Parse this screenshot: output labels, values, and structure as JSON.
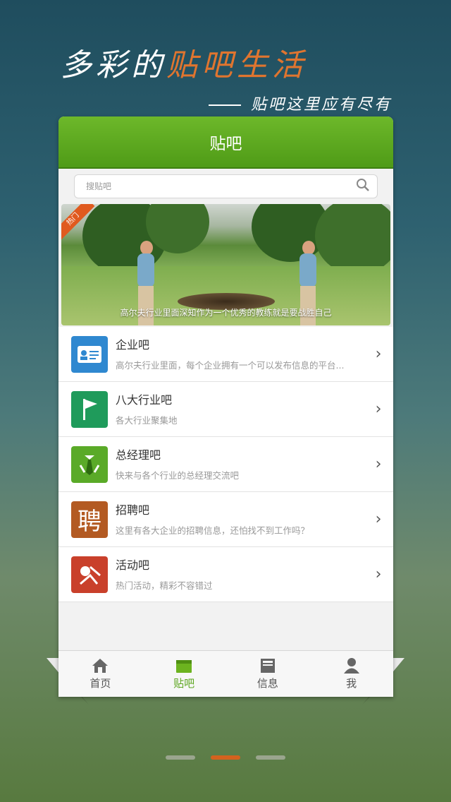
{
  "promo": {
    "headline_white": "多彩的",
    "headline_accent": "贴吧生活",
    "tagline": "贴吧这里应有尽有"
  },
  "app": {
    "title": "贴吧",
    "search": {
      "placeholder": "搜贴吧"
    },
    "banner": {
      "badge": "热门",
      "caption": "高尔夫行业里面深知作为一个优秀的教练就是要战胜自己"
    },
    "items": [
      {
        "title": "企业吧",
        "desc": "高尔夫行业里面，每个企业拥有一个可以发布信息的平台...",
        "icon": "id-card-icon",
        "color": "#2f88d0"
      },
      {
        "title": "八大行业吧",
        "desc": "各大行业聚集地",
        "icon": "flag-icon",
        "color": "#1f9b5b"
      },
      {
        "title": "总经理吧",
        "desc": "快来与各个行业的总经理交流吧",
        "icon": "tie-icon",
        "color": "#5aaa28"
      },
      {
        "title": "招聘吧",
        "desc": "这里有各大企业的招聘信息，还怕找不到工作吗？",
        "icon": "hire-icon",
        "icon_text": "聘",
        "color": "#b35a22"
      },
      {
        "title": "活动吧",
        "desc": "热门活动，精彩不容错过",
        "icon": "golf-flag-icon",
        "color": "#c9402b"
      }
    ],
    "tabs": [
      {
        "label": "首页",
        "icon": "home-icon"
      },
      {
        "label": "贴吧",
        "icon": "folder-icon",
        "active": true
      },
      {
        "label": "信息",
        "icon": "news-icon"
      },
      {
        "label": "我",
        "icon": "person-icon"
      }
    ]
  },
  "pager": {
    "count": 3,
    "active_index": 1
  }
}
